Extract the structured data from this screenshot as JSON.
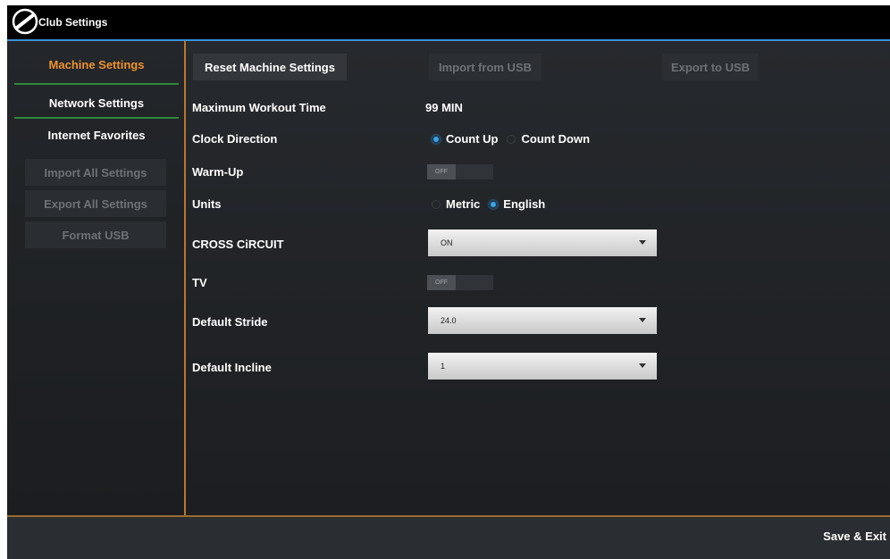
{
  "titlebar": {
    "title": "Club Settings",
    "logo_icon": "brand-logo-icon"
  },
  "sidebar": {
    "items": [
      {
        "label": "Machine Settings",
        "active": true
      },
      {
        "label": "Network Settings",
        "active": false
      },
      {
        "label": "Internet Favorites",
        "active": false
      }
    ],
    "buttons": [
      {
        "label": "Import All Settings",
        "enabled": false
      },
      {
        "label": "Export All Settings",
        "enabled": false
      },
      {
        "label": "Format USB",
        "enabled": false
      }
    ]
  },
  "main": {
    "top_buttons": {
      "reset": "Reset Machine Settings",
      "import": "Import from USB",
      "export": "Export to USB"
    },
    "max_workout": {
      "label": "Maximum Workout Time",
      "value": "99 MIN"
    },
    "clock_direction": {
      "label": "Clock Direction",
      "options": [
        "Count Up",
        "Count Down"
      ],
      "selected": "Count Up"
    },
    "warmup": {
      "label": "Warm-Up",
      "state": "OFF"
    },
    "units": {
      "label": "Units",
      "options": [
        "Metric",
        "English"
      ],
      "selected": "English"
    },
    "cross_circuit": {
      "label": "CROSS CiRCUIT",
      "value": "ON"
    },
    "tv": {
      "label": "TV",
      "state": "OFF"
    },
    "default_stride": {
      "label": "Default Stride",
      "value": "24.0"
    },
    "default_incline": {
      "label": "Default Incline",
      "value": "1"
    }
  },
  "footer": {
    "save_exit": "Save & Exit"
  },
  "colors": {
    "accent_orange": "#f0922a",
    "accent_blue": "#39a3e8",
    "divider_green": "#2d8a3a",
    "titlebar_line": "#3c8fd6"
  }
}
